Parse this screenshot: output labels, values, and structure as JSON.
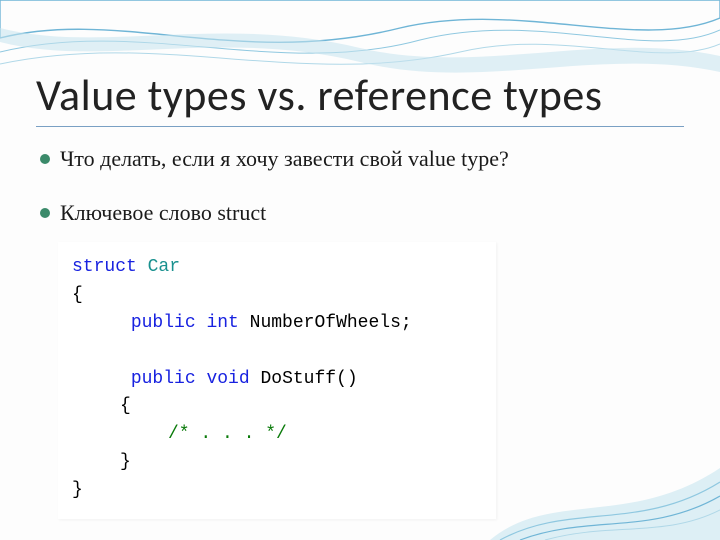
{
  "title": "Value types vs. reference types",
  "bullets": [
    "Что делать, если я хочу завести свой value type?",
    "Ключевое слово struct"
  ],
  "code": {
    "kw_struct": "struct",
    "type_car": "Car",
    "lbrace": "{",
    "kw_public1": "public",
    "kw_int": "int",
    "field": "NumberOfWheels;",
    "kw_public2": "public",
    "kw_void": "void",
    "method": "DoStuff()",
    "lbrace2": "{",
    "comment": "/* . . . */",
    "rbrace2": "}",
    "rbrace": "}"
  }
}
